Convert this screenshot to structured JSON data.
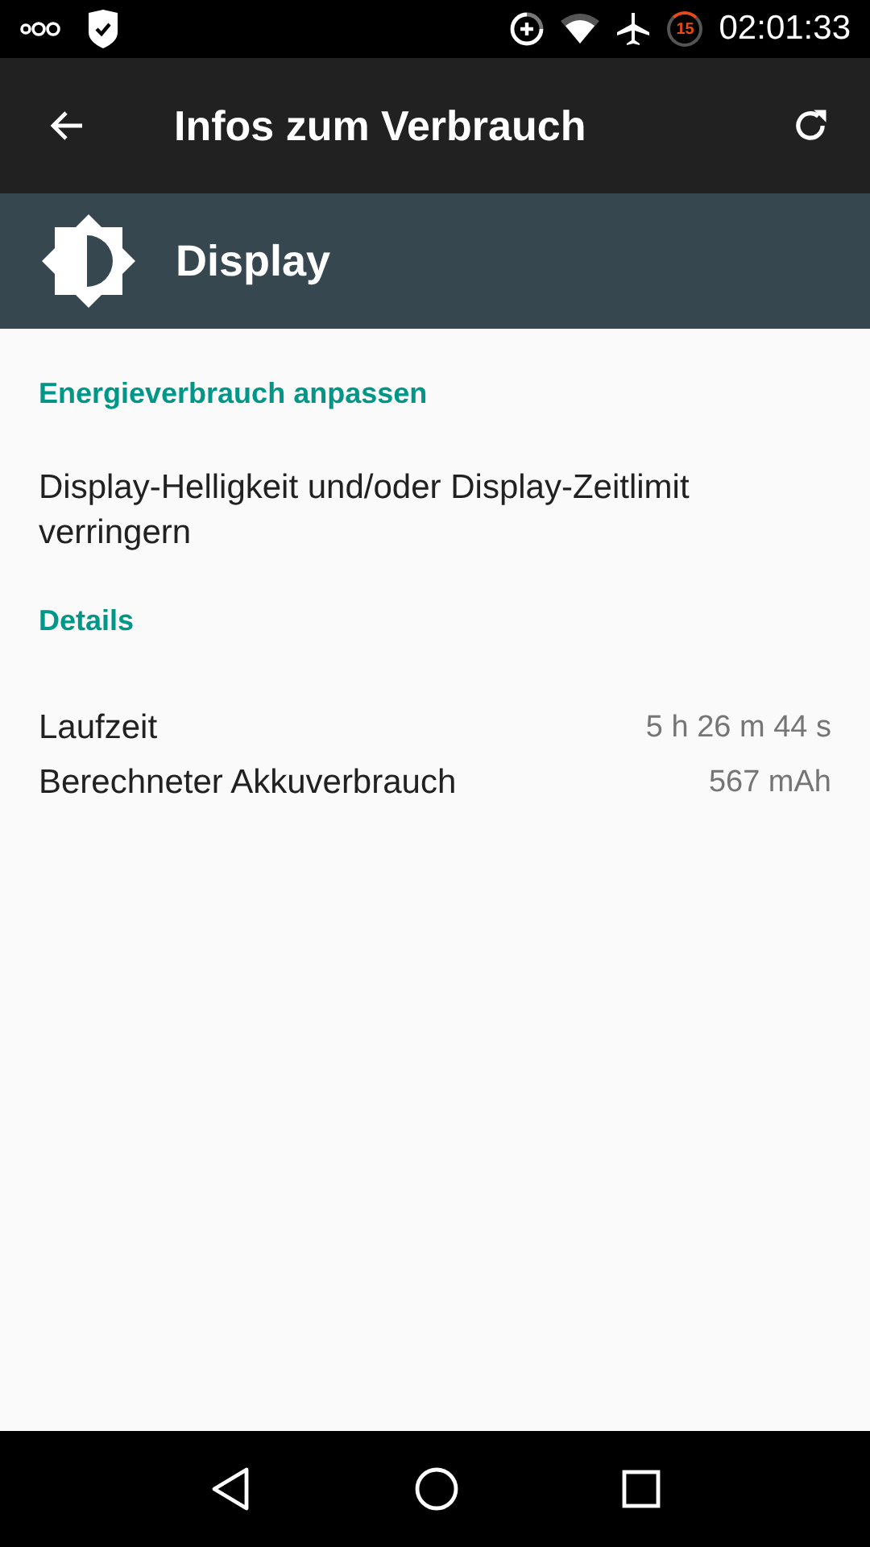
{
  "status_bar": {
    "timer_badge": "15",
    "time": "02:01:33"
  },
  "app_bar": {
    "title": "Infos zum Verbrauch"
  },
  "header": {
    "title": "Display"
  },
  "sections": [
    {
      "kind": "text",
      "heading": "Energieverbrauch anpassen",
      "text": "Display-Helligkeit und/oder Display-Zeitlimit verringern"
    },
    {
      "kind": "details",
      "heading": "Details",
      "rows": [
        {
          "label": "Laufzeit",
          "value": "5 h 26 m 44 s"
        },
        {
          "label": "Berechneter Akkuverbrauch",
          "value": "567 mAh"
        }
      ]
    }
  ]
}
